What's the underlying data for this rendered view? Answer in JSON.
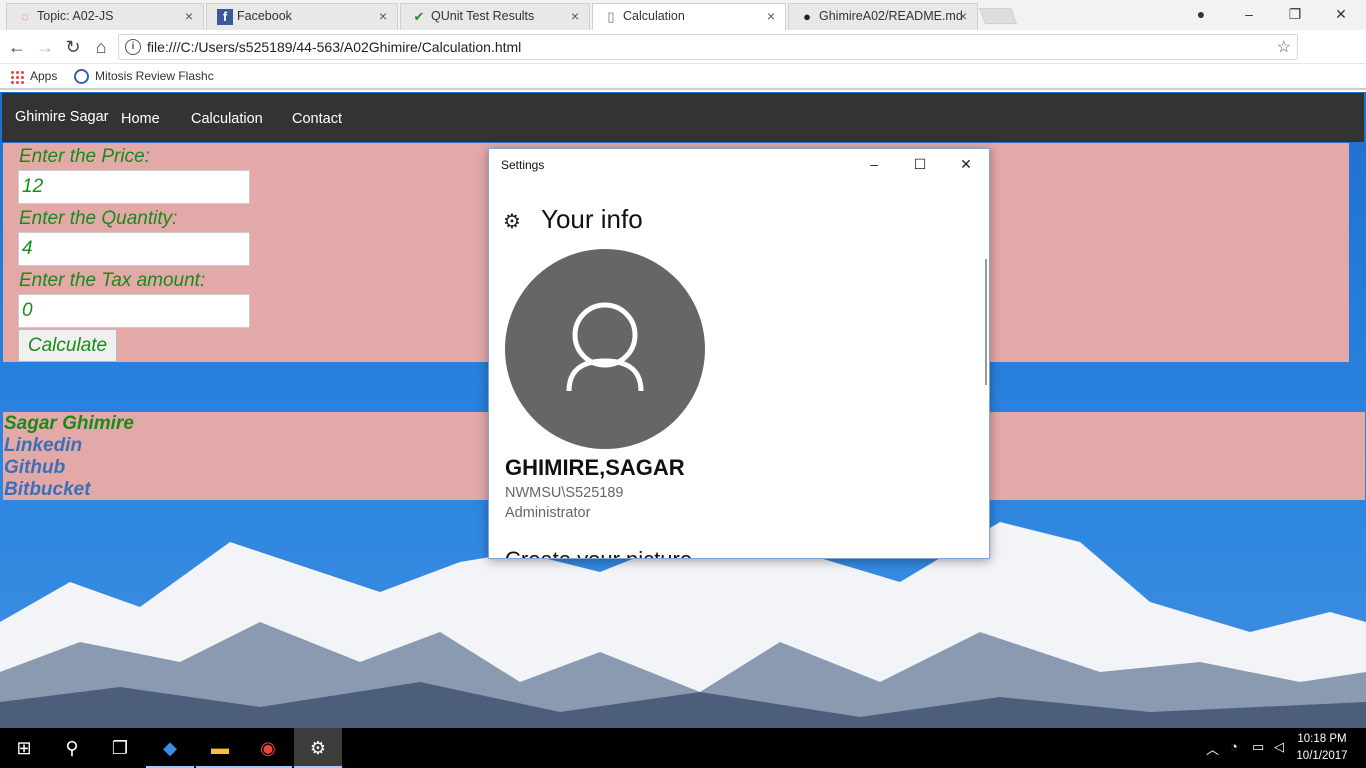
{
  "browser": {
    "tabs": [
      {
        "title": "Topic: A02-JS",
        "icon": "discussion-icon",
        "close": "×"
      },
      {
        "title": "Facebook",
        "icon": "facebook-icon",
        "close": "×"
      },
      {
        "title": "QUnit Test Results",
        "icon": "page-check-icon",
        "close": "×"
      },
      {
        "title": "Calculation",
        "icon": "page-icon",
        "close": "×"
      },
      {
        "title": "GhimireA02/README.md",
        "icon": "github-icon",
        "close": "×"
      }
    ],
    "url": "file:///C:/Users/s525189/44-563/A02Ghimire/Calculation.html",
    "bookmarks": {
      "apps": "Apps",
      "mitosis": "Mitosis Review Flashc"
    },
    "window_controls": {
      "minimize": "–",
      "restore": "❐",
      "close": "✕"
    }
  },
  "page": {
    "nav": {
      "brand": "Ghimire Sagar",
      "links": [
        "Home",
        "Calculation",
        "Contact"
      ]
    },
    "form": {
      "price_label": "Enter the Price:",
      "price_value": "12",
      "quantity_label": "Enter the Quantity:",
      "quantity_value": "4",
      "tax_label": "Enter the Tax amount:",
      "tax_value": "0",
      "calculate_label": "Calculate"
    },
    "footer": {
      "name": "Sagar Ghimire",
      "links": [
        "Linkedin",
        "Github",
        "Bitbucket"
      ]
    }
  },
  "settings_window": {
    "title": "Settings",
    "heading": "Your info",
    "user_name": "GHIMIRE,SAGAR",
    "account": "NWMSU\\S525189",
    "role": "Administrator",
    "cutoff_text": "Create your picture"
  },
  "taskbar": {
    "time": "10:18 PM",
    "date": "10/1/2017"
  },
  "colors": {
    "nav_bg": "#333333",
    "panel_bg": "#e2a9a8",
    "label_green": "#1a8a1a",
    "link_blue": "#3c6fb5",
    "avatar_gray": "#666666"
  }
}
